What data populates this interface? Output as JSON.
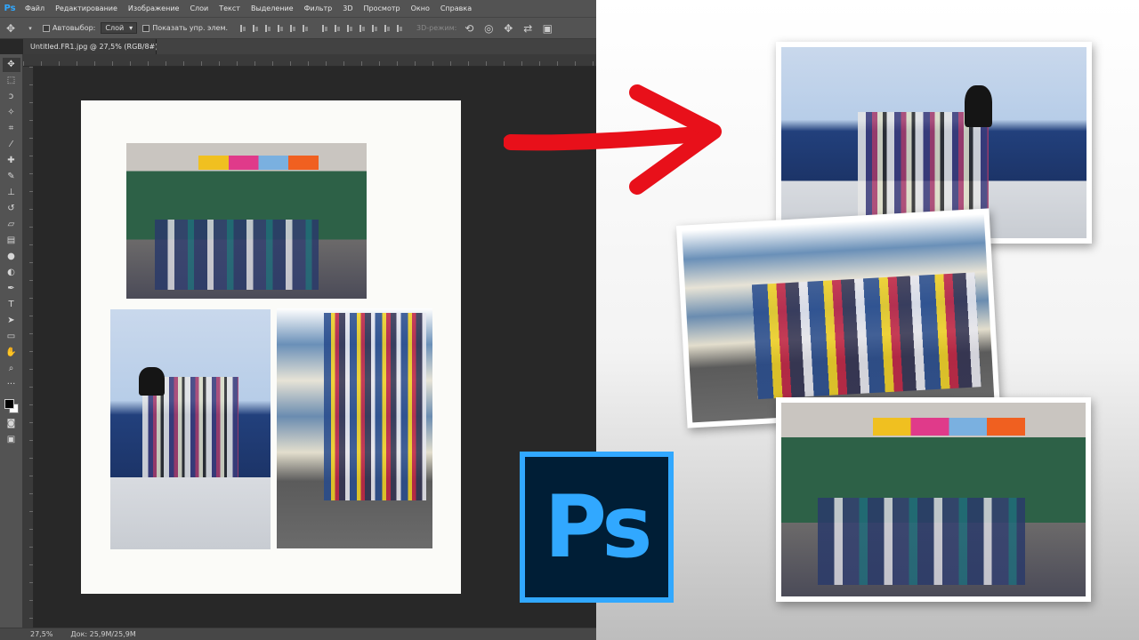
{
  "app": {
    "logo_text": "Ps",
    "menu": [
      "Файл",
      "Редактирование",
      "Изображение",
      "Слои",
      "Текст",
      "Выделение",
      "Фильтр",
      "3D",
      "Просмотр",
      "Окно",
      "Справка"
    ]
  },
  "options_bar": {
    "autoselect_label": "Автовыбор:",
    "autoselect_value": "Слой",
    "show_controls_label": "Показать упр. элем.",
    "mode_3d_label": "3D-режим:"
  },
  "document": {
    "tab_title": "Untitled.FR1.jpg @ 27,5% (RGB/8#) *",
    "close_glyph": "×"
  },
  "status": {
    "zoom": "27,5%",
    "doc_info": "Док: 25,9M/25,9M"
  },
  "icons": {
    "tools": [
      "move-icon",
      "marquee-icon",
      "lasso-icon",
      "magic-wand-icon",
      "crop-icon",
      "eyedropper-icon",
      "healing-brush-icon",
      "brush-icon",
      "clone-stamp-icon",
      "history-brush-icon",
      "eraser-icon",
      "gradient-icon",
      "blur-icon",
      "dodge-icon",
      "pen-icon",
      "type-icon",
      "path-selection-icon",
      "rectangle-icon",
      "hand-icon",
      "zoom-icon",
      "more-tools-icon"
    ]
  },
  "badge": {
    "text": "Ps"
  },
  "colors": {
    "accent": "#31a8ff",
    "badge_bg": "#001e36",
    "arrow": "#e8101a"
  }
}
